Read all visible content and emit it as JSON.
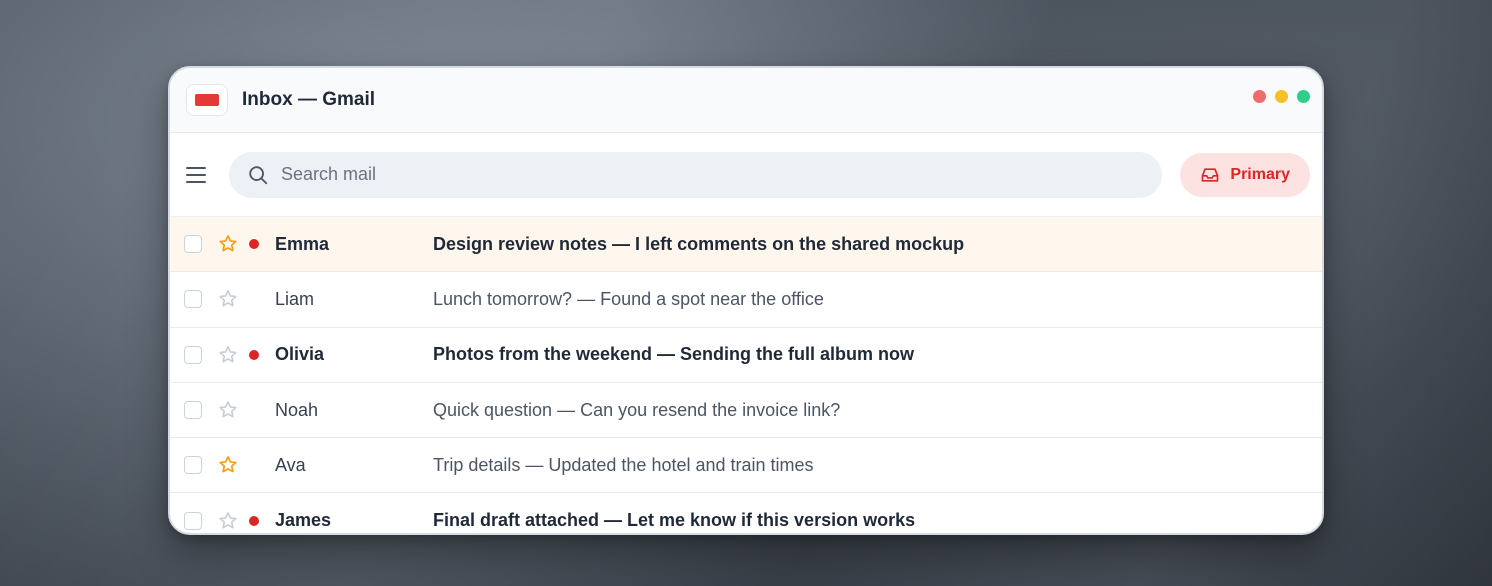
{
  "window": {
    "title": "Inbox — Gmail",
    "app_icon": "gmail-icon",
    "controls": [
      {
        "name": "close",
        "color": "#f06b6b"
      },
      {
        "name": "minimize",
        "color": "#f6c026"
      },
      {
        "name": "maximize",
        "color": "#2fcf8b"
      }
    ]
  },
  "toolbar": {
    "menu_icon": "hamburger-icon",
    "search_icon": "search-icon",
    "search_placeholder": "Search mail",
    "search_value": "",
    "primary_label": "Primary",
    "primary_icon": "inbox-tray-icon"
  },
  "colors": {
    "accent": "#dc2626",
    "star_active": "#f59e0b",
    "star_inactive": "#c7ced8",
    "unread_dot": "#dc2626",
    "highlight_row": "#fff7ed"
  },
  "emails": [
    {
      "sender": "Emma",
      "subject": "Design review notes — I left comments on the shared mockup",
      "starred": true,
      "unread": true,
      "highlighted": true
    },
    {
      "sender": "Liam",
      "subject": "Lunch tomorrow? — Found a spot near the office",
      "starred": false,
      "unread": false,
      "highlighted": false
    },
    {
      "sender": "Olivia",
      "subject": "Photos from the weekend — Sending the full album now",
      "starred": false,
      "unread": true,
      "highlighted": false
    },
    {
      "sender": "Noah",
      "subject": "Quick question — Can you resend the invoice link?",
      "starred": false,
      "unread": false,
      "highlighted": false
    },
    {
      "sender": "Ava",
      "subject": "Trip details — Updated the hotel and train times",
      "starred": true,
      "unread": false,
      "highlighted": false
    },
    {
      "sender": "James",
      "subject": "Final draft attached — Let me know if this version works",
      "starred": false,
      "unread": true,
      "highlighted": false
    }
  ]
}
